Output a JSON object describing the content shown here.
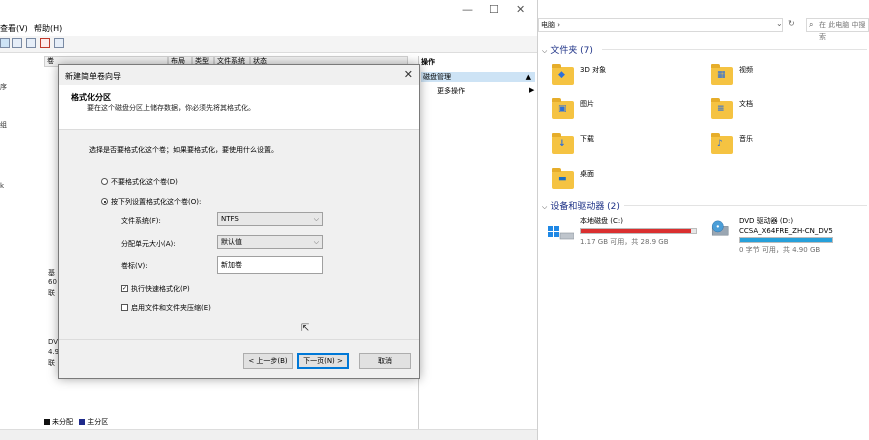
{
  "disk_mgmt": {
    "menu": [
      "查看(V)",
      "帮助(H)"
    ],
    "columns": [
      "卷",
      "布局",
      "类型",
      "文件系统",
      "状态"
    ],
    "left_labels": [
      "序",
      "组",
      "k"
    ],
    "disk_labels": [
      "基",
      "60",
      "联",
      "DV",
      "4.9",
      "联"
    ],
    "action_pane": {
      "header": "操作",
      "selected": "磁盘管理",
      "more": "更多操作"
    },
    "legend": {
      "unallocated": "未分配",
      "primary": "主分区"
    },
    "colors": {
      "unallocated": "#111111",
      "primary": "#1e2a8a"
    }
  },
  "wizard": {
    "title": "新建简单卷向导",
    "header_title": "格式化分区",
    "header_desc": "要在这个磁盘分区上储存数据，你必须先将其格式化。",
    "prompt": "选择是否要格式化这个卷；如果要格式化，要使用什么设置。",
    "radio_no": "不要格式化这个卷(D)",
    "radio_yes": "按下列设置格式化这个卷(O):",
    "fs_label": "文件系统(F):",
    "fs_value": "NTFS",
    "alloc_label": "分配单元大小(A):",
    "alloc_value": "默认值",
    "vol_label": "卷标(V):",
    "vol_value": "新加卷",
    "quick_format": "执行快速格式化(P)",
    "compress": "启用文件和文件夹压缩(E)",
    "btn_back": "< 上一步(B)",
    "btn_next": "下一页(N) >",
    "btn_cancel": "取消"
  },
  "explorer": {
    "address": "电脑 ›",
    "search_placeholder": "在 此电脑 中搜索",
    "folders_header": "文件夹 (7)",
    "folders": [
      "3D 对象",
      "视频",
      "图片",
      "文档",
      "下载",
      "音乐",
      "桌面"
    ],
    "devices_header": "设备和驱动器 (2)",
    "drives": [
      {
        "name": "本地磁盘 (C:)",
        "sub": "",
        "space": "1.17 GB 可用，共 28.9 GB",
        "used_fraction": 0.96,
        "bar_color": "#da2f2f"
      },
      {
        "name": "DVD 驱动器 (D:)",
        "sub": "CCSA_X64FRE_ZH-CN_DV5",
        "space": "0 字节 可用，共 4.90 GB",
        "used_fraction": 1.0,
        "bar_color": "#26a0da"
      }
    ]
  }
}
